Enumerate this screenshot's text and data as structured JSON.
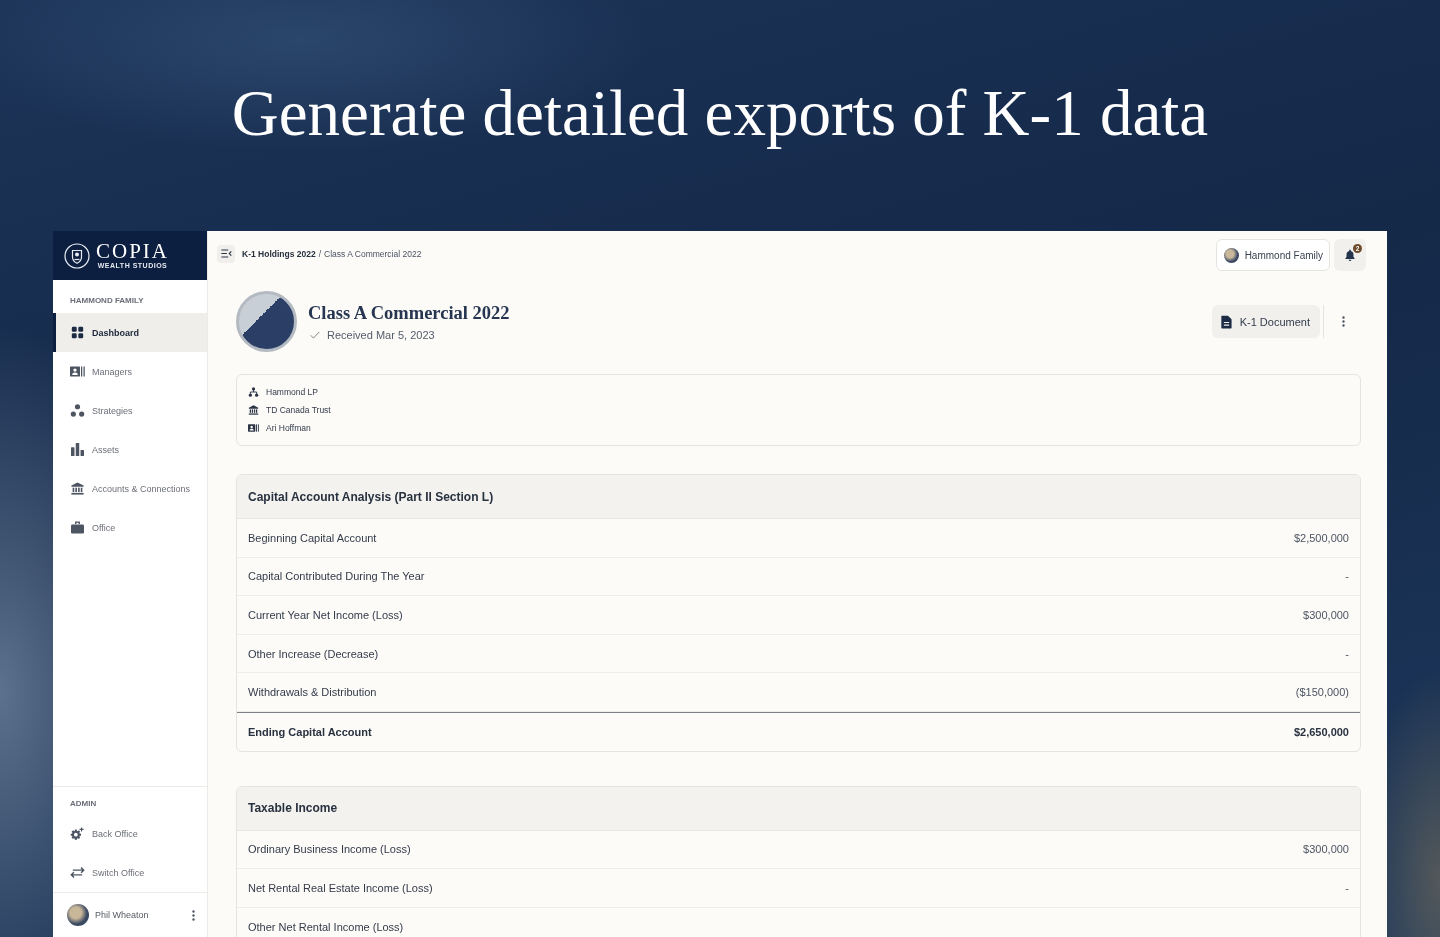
{
  "headline": "Generate detailed exports of K-1 data",
  "brand": {
    "name": "COPIA",
    "tagline": "WEALTH STUDIOS"
  },
  "sidebar": {
    "section_label": "HAMMOND FAMILY",
    "items": [
      {
        "label": "Dashboard",
        "selected": true
      },
      {
        "label": "Managers",
        "selected": false
      },
      {
        "label": "Strategies",
        "selected": false
      },
      {
        "label": "Assets",
        "selected": false
      },
      {
        "label": "Accounts & Connections",
        "selected": false
      },
      {
        "label": "Office",
        "selected": false
      }
    ],
    "admin_label": "ADMIN",
    "admin_items": [
      {
        "label": "Back Office"
      },
      {
        "label": "Switch Office"
      }
    ],
    "user": {
      "name": "Phil Wheaton"
    }
  },
  "topbar": {
    "breadcrumb": {
      "separator": "/",
      "items": [
        {
          "label": "K-1 Holdings 2022",
          "current": false
        },
        {
          "label": "Class A Commercial 2022",
          "current": true
        }
      ]
    },
    "account": {
      "label": "Hammond Family"
    },
    "notifications": {
      "count": "2"
    }
  },
  "header": {
    "title": "Class A Commercial 2022",
    "status": "Received Mar 5, 2023",
    "document_button": "K-1 Document"
  },
  "entities": [
    "Hammond LP",
    "TD Canada Trust",
    "Ari Hoffman"
  ],
  "tables": [
    {
      "title": "Capital Account Analysis (Part II Section L)",
      "rows": [
        {
          "kind": "line",
          "label": "Beginning Capital Account",
          "value": "$2,500,000"
        },
        {
          "kind": "line",
          "label": "Capital Contributed During The Year",
          "value": "-"
        },
        {
          "kind": "line",
          "label": "Current Year Net Income (Loss)",
          "value": "$300,000"
        },
        {
          "kind": "line",
          "label": "Other Increase (Decrease)",
          "value": "-"
        },
        {
          "kind": "line",
          "label": "Withdrawals & Distribution",
          "value": "($150,000)"
        },
        {
          "kind": "total",
          "label": "Ending Capital Account",
          "value": "$2,650,000"
        }
      ]
    },
    {
      "title": "Taxable Income",
      "rows": [
        {
          "kind": "line",
          "label": "Ordinary Business Income (Loss)",
          "value": "$300,000"
        },
        {
          "kind": "line",
          "label": "Net Rental Real Estate Income (Loss)",
          "value": "-"
        },
        {
          "kind": "line",
          "label": "Other Net Rental Income (Loss)"
        }
      ]
    }
  ]
}
